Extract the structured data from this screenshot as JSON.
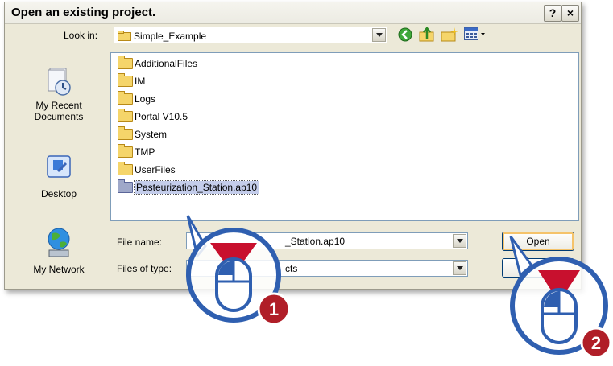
{
  "dialog": {
    "title": "Open an existing project.",
    "help": "?",
    "close": "×"
  },
  "lookin": {
    "label": "Look in:",
    "value": "Simple_Example"
  },
  "places": [
    {
      "label": "My Recent\nDocuments",
      "line1": "My Recent",
      "line2": "Documents"
    },
    {
      "label": "Desktop"
    },
    {
      "label": "My Network"
    }
  ],
  "files": [
    "AdditionalFiles",
    "IM",
    "Logs",
    "Portal V10.5",
    "System",
    "TMP",
    "UserFiles",
    "Pasteurization_Station.ap10"
  ],
  "filename": {
    "label": "File name:",
    "value": "_Station.ap10"
  },
  "filetype": {
    "label": "Files of type:",
    "value": "cts"
  },
  "buttons": {
    "open": "Open"
  },
  "markers": {
    "one": "1",
    "two": "2"
  },
  "colors": {
    "callout_blue": "#2f5fb0",
    "marker_red": "#b01e28"
  }
}
